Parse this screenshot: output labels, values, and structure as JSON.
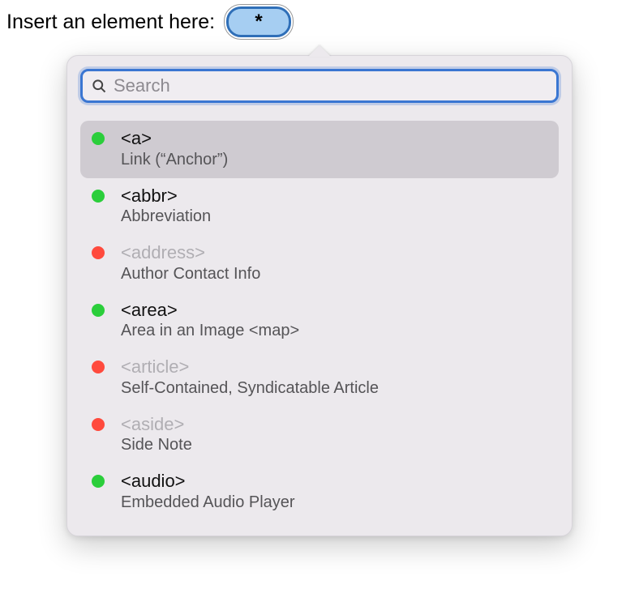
{
  "prompt": {
    "label": "Insert an element here:",
    "button_text": "*"
  },
  "search": {
    "placeholder": "Search",
    "value": ""
  },
  "items": [
    {
      "tag": "<a>",
      "desc": "Link (“Anchor”)",
      "status": "green",
      "selected": true
    },
    {
      "tag": "<abbr>",
      "desc": "Abbreviation",
      "status": "green",
      "selected": false
    },
    {
      "tag": "<address>",
      "desc": "Author Contact Info",
      "status": "red",
      "selected": false
    },
    {
      "tag": "<area>",
      "desc": "Area in an Image <map>",
      "status": "green",
      "selected": false
    },
    {
      "tag": "<article>",
      "desc": "Self-Contained, Syndicatable Article",
      "status": "red",
      "selected": false
    },
    {
      "tag": "<aside>",
      "desc": "Side Note",
      "status": "red",
      "selected": false
    },
    {
      "tag": "<audio>",
      "desc": "Embedded Audio Player",
      "status": "green",
      "selected": false
    }
  ]
}
